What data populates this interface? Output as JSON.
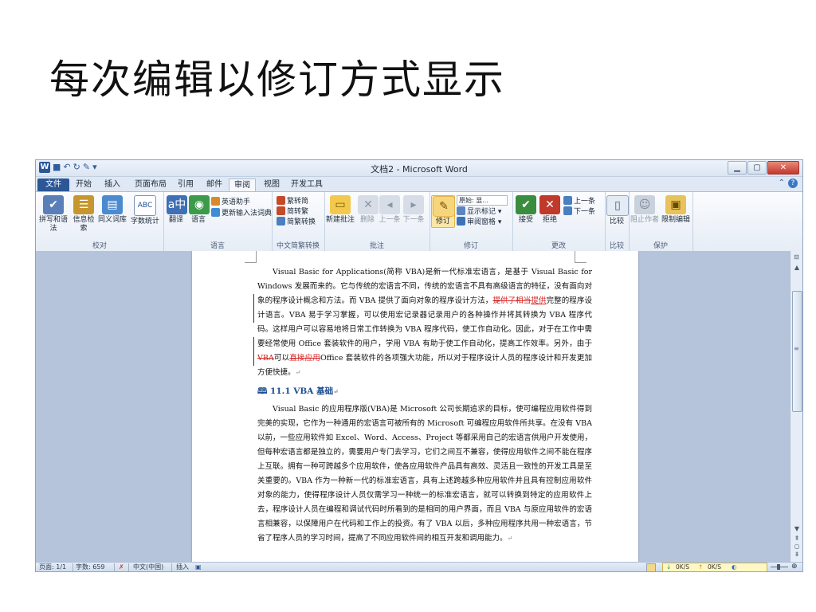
{
  "slide": {
    "title": "每次编辑以修订方式显示"
  },
  "window": {
    "title": "文档2 - Microsoft Word",
    "qat_icons": [
      "word-logo-icon",
      "save-icon",
      "undo-icon",
      "redo-icon",
      "format-painter-icon",
      "customize-icon"
    ]
  },
  "tabs": [
    {
      "id": "file",
      "label": "文件"
    },
    {
      "id": "home",
      "label": "开始"
    },
    {
      "id": "insert",
      "label": "插入"
    },
    {
      "id": "layout",
      "label": "页面布局"
    },
    {
      "id": "references",
      "label": "引用"
    },
    {
      "id": "mailings",
      "label": "邮件"
    },
    {
      "id": "review",
      "label": "审阅"
    },
    {
      "id": "view",
      "label": "视图"
    },
    {
      "id": "developer",
      "label": "开发工具"
    }
  ],
  "ribbon": {
    "proofing": {
      "label": "校对",
      "spelling": "拼写和语法",
      "research": "信息检索",
      "thesaurus": "同义词库",
      "wordcount": "字数统计"
    },
    "language": {
      "label": "语言",
      "translate": "翻译",
      "language": "语言",
      "english_assistant": "英语助手",
      "update_ime": "更新输入法词典"
    },
    "chinese": {
      "label": "中文简繁转换",
      "to_simplified": "繁转简",
      "to_traditional": "简转繁",
      "convert": "简繁转换"
    },
    "comments": {
      "label": "批注",
      "new": "新建批注",
      "delete": "删除",
      "prev": "上一条",
      "next": "下一条"
    },
    "tracking": {
      "label": "修订",
      "track": "修订",
      "display_mode": "原始: 显...",
      "show_markup": "显示标记 ▾",
      "reviewing_pane": "审阅窗格 ▾"
    },
    "changes": {
      "label": "更改",
      "accept": "接受",
      "reject": "拒绝",
      "prev": "上一条",
      "next": "下一条"
    },
    "compare": {
      "label": "比较",
      "compare": "比较"
    },
    "protect": {
      "label": "保护",
      "block_authors": "阻止作者",
      "restrict": "限制编辑"
    }
  },
  "document": {
    "p1_a": "Visual Basic for Applications(简称 VBA)是新一代标准宏语言，是基于 Visual Basic for Windows 发展而来的。它与传统的宏语言不同，传统的宏语言不具有高级语言的特征，没有面向对象的程序设计概念和方法。而 VBA 提供了面向对象的程序设计方法，",
    "p1_del": "提供了相当",
    "p1_ins": "提供",
    "p1_b": "完整的程序设计语言。VBA 易于学习掌握，可以使用宏记录器记录用户的各种操作并将其转换为 VBA 程序代码。这样用户可以容易地将日常工作转换为 VBA 程序代码，使工作自动化。因此，对于在工作中需要经常使用 Office 套装软件的用户，学用 VBA 有助于使工作自动化，提高工作效率。另外，由于",
    "p1_del2": "VBA",
    "p1_c": "可以",
    "p1_del3": "直接应用",
    "p1_d": "Office 套装软件的各项强大功能，所以对于程序设计人员的程序设计和开发更加方便快捷。",
    "heading": "11.1 VBA  基础",
    "p2": "Visual Basic 的应用程序版(VBA)是 Microsoft 公司长期追求的目标，使可编程应用软件得到完美的实现，它作为一种通用的宏语言可被所有的 Microsoft 可编程应用软件所共享。在没有 VBA 以前，一些应用软件如 Excel、Word、Access、Project 等都采用自己的宏语言供用户开发使用，但每种宏语言都是独立的，需要用户专门去学习，它们之间互不兼容，使得应用软件之间不能在程序上互联。拥有一种可跨越多个应用软件，使各应用软件产品具有高效、灵活且一致性的开发工具是至关重要的。VBA 作为一种新一代的标准宏语言，具有上述跨越多种应用软件并且具有控制应用软件对象的能力，使得程序设计人员仅需学习一种统一的标准宏语言，就可以转换到特定的应用软件上去，程序设计人员在编程和调试代码时所看到的是相同的用户界面，而且 VBA 与原应用软件的宏语言相兼容，以保障用户在代码和工作上的投资。有了 VBA 以后，多种应用程序共用一种宏语言，节省了程序人员的学习时间，提高了不同应用软件间的相互开发和调用能力。"
  },
  "statusbar": {
    "page": "页面: 1/1",
    "words": "字数: 659",
    "lang": "中文(中国)",
    "mode": "插入",
    "down_speed": "0K/S",
    "up_speed": "0K/S"
  }
}
